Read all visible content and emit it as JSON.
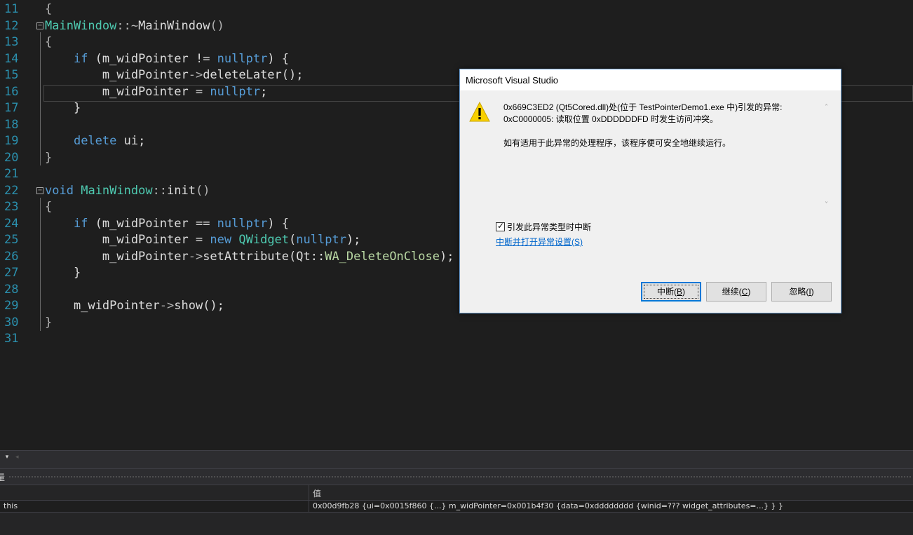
{
  "editor": {
    "lines": [
      {
        "no": "11",
        "tokens": [
          {
            "t": "{",
            "c": "tok-punct"
          }
        ]
      },
      {
        "no": "12",
        "tokens": [
          {
            "t": "MainWindow",
            "c": "tok-type"
          },
          {
            "t": "::~",
            "c": "tok-punct"
          },
          {
            "t": "MainWindow",
            "c": "tok-fn"
          },
          {
            "t": "()",
            "c": "tok-punct"
          }
        ]
      },
      {
        "no": "13",
        "tokens": [
          {
            "t": "{",
            "c": "tok-punct"
          }
        ]
      },
      {
        "no": "14",
        "tokens": [
          {
            "t": "    ",
            "c": ""
          },
          {
            "t": "if",
            "c": "tok-kw"
          },
          {
            "t": " (m_widPointer != ",
            "c": ""
          },
          {
            "t": "nullptr",
            "c": "tok-kw"
          },
          {
            "t": ") {",
            "c": ""
          }
        ]
      },
      {
        "no": "15",
        "tokens": [
          {
            "t": "        m_widPointer",
            "c": ""
          },
          {
            "t": "->",
            "c": "tok-punct"
          },
          {
            "t": "deleteLater",
            "c": "tok-fn"
          },
          {
            "t": "();",
            "c": ""
          }
        ]
      },
      {
        "no": "16",
        "tokens": [
          {
            "t": "        m_widPointer = ",
            "c": ""
          },
          {
            "t": "nullptr",
            "c": "tok-kw"
          },
          {
            "t": ";",
            "c": ""
          }
        ]
      },
      {
        "no": "17",
        "tokens": [
          {
            "t": "    }",
            "c": ""
          }
        ]
      },
      {
        "no": "18",
        "tokens": []
      },
      {
        "no": "19",
        "tokens": [
          {
            "t": "    ",
            "c": ""
          },
          {
            "t": "delete",
            "c": "tok-kw"
          },
          {
            "t": " ui;",
            "c": ""
          }
        ]
      },
      {
        "no": "20",
        "tokens": [
          {
            "t": "}",
            "c": "tok-punct"
          }
        ]
      },
      {
        "no": "21",
        "tokens": []
      },
      {
        "no": "22",
        "tokens": [
          {
            "t": "void",
            "c": "tok-kw"
          },
          {
            "t": " ",
            "c": ""
          },
          {
            "t": "MainWindow",
            "c": "tok-type"
          },
          {
            "t": "::",
            "c": "tok-punct"
          },
          {
            "t": "init",
            "c": "tok-fn"
          },
          {
            "t": "()",
            "c": "tok-punct"
          }
        ]
      },
      {
        "no": "23",
        "tokens": [
          {
            "t": "{",
            "c": "tok-punct"
          }
        ]
      },
      {
        "no": "24",
        "tokens": [
          {
            "t": "    ",
            "c": ""
          },
          {
            "t": "if",
            "c": "tok-kw"
          },
          {
            "t": " (m_widPointer == ",
            "c": ""
          },
          {
            "t": "nullptr",
            "c": "tok-kw"
          },
          {
            "t": ") {",
            "c": ""
          }
        ]
      },
      {
        "no": "25",
        "tokens": [
          {
            "t": "        m_widPointer = ",
            "c": ""
          },
          {
            "t": "new",
            "c": "tok-kw"
          },
          {
            "t": " ",
            "c": ""
          },
          {
            "t": "QWidget",
            "c": "tok-type"
          },
          {
            "t": "(",
            "c": ""
          },
          {
            "t": "nullptr",
            "c": "tok-kw"
          },
          {
            "t": ");",
            "c": ""
          }
        ]
      },
      {
        "no": "26",
        "tokens": [
          {
            "t": "        m_widPointer",
            "c": ""
          },
          {
            "t": "->",
            "c": "tok-punct"
          },
          {
            "t": "setAttribute",
            "c": "tok-fn"
          },
          {
            "t": "(Qt::",
            "c": ""
          },
          {
            "t": "WA_DeleteOnClose",
            "c": "tok-enum"
          },
          {
            "t": ");",
            "c": ""
          }
        ]
      },
      {
        "no": "27",
        "tokens": [
          {
            "t": "    }",
            "c": ""
          }
        ]
      },
      {
        "no": "28",
        "tokens": []
      },
      {
        "no": "29",
        "tokens": [
          {
            "t": "    m_widPointer",
            "c": ""
          },
          {
            "t": "->",
            "c": "tok-punct"
          },
          {
            "t": "show",
            "c": "tok-fn"
          },
          {
            "t": "();",
            "c": ""
          }
        ]
      },
      {
        "no": "30",
        "tokens": [
          {
            "t": "}",
            "c": "tok-punct"
          }
        ]
      },
      {
        "no": "31",
        "tokens": []
      }
    ]
  },
  "locals_panel": {
    "title": "量",
    "value_header": "值",
    "rows": [
      {
        "name": "this",
        "value": "0x00d9fb28 {ui=0x0015f860 {...} m_widPointer=0x001b4f30 {data=0xdddddddd {winid=??? widget_attributes=...} } }"
      }
    ]
  },
  "dialog": {
    "title": "Microsoft Visual Studio",
    "message_line1": "0x669C3ED2 (Qt5Cored.dll)处(位于 TestPointerDemo1.exe 中)引发的异常: ",
    "message_line2": "0xC0000005: 读取位置 0xDDDDDDFD 时发生访问冲突。",
    "message_line3": "如有适用于此异常的处理程序，该程序便可安全地继续运行。",
    "checkbox_label": "引发此异常类型时中断",
    "checkbox_checked": true,
    "checkbox_mark": "✓",
    "link_label": "中断并打开异常设置(S)",
    "buttons": {
      "break": {
        "text": "中断(",
        "key": "B",
        "end": ")"
      },
      "continue": {
        "text": "继续(",
        "key": "C",
        "end": ")"
      },
      "ignore": {
        "text": "忽略(",
        "key": "I",
        "end": ")"
      }
    }
  },
  "glyphs": {
    "dropdown": "▾",
    "scroll_left": "◂",
    "scroll_up": "˄",
    "scroll_down": "˅",
    "fold_minus": "−"
  },
  "colors": {
    "editor_bg": "#1e1e1e",
    "line_number": "#2b91af",
    "keyword": "#569cd6",
    "type": "#4ec9b0",
    "enum": "#b8d7a3",
    "dialog_border": "#6fa3d8",
    "default_button_border": "#0078d7",
    "warning_yellow": "#f8d000"
  }
}
